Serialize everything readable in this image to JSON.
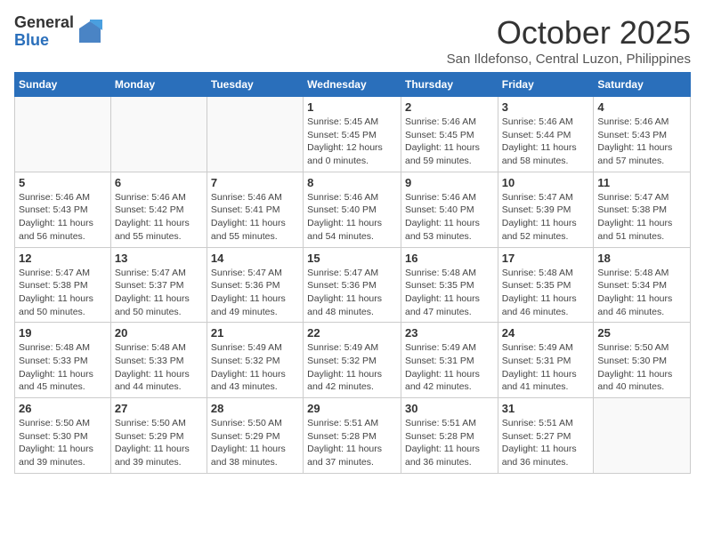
{
  "logo": {
    "general": "General",
    "blue": "Blue"
  },
  "title": "October 2025",
  "subtitle": "San Ildefonso, Central Luzon, Philippines",
  "days_of_week": [
    "Sunday",
    "Monday",
    "Tuesday",
    "Wednesday",
    "Thursday",
    "Friday",
    "Saturday"
  ],
  "weeks": [
    [
      {
        "day": "",
        "info": ""
      },
      {
        "day": "",
        "info": ""
      },
      {
        "day": "",
        "info": ""
      },
      {
        "day": "1",
        "info": "Sunrise: 5:45 AM\nSunset: 5:45 PM\nDaylight: 12 hours\nand 0 minutes."
      },
      {
        "day": "2",
        "info": "Sunrise: 5:46 AM\nSunset: 5:45 PM\nDaylight: 11 hours\nand 59 minutes."
      },
      {
        "day": "3",
        "info": "Sunrise: 5:46 AM\nSunset: 5:44 PM\nDaylight: 11 hours\nand 58 minutes."
      },
      {
        "day": "4",
        "info": "Sunrise: 5:46 AM\nSunset: 5:43 PM\nDaylight: 11 hours\nand 57 minutes."
      }
    ],
    [
      {
        "day": "5",
        "info": "Sunrise: 5:46 AM\nSunset: 5:43 PM\nDaylight: 11 hours\nand 56 minutes."
      },
      {
        "day": "6",
        "info": "Sunrise: 5:46 AM\nSunset: 5:42 PM\nDaylight: 11 hours\nand 55 minutes."
      },
      {
        "day": "7",
        "info": "Sunrise: 5:46 AM\nSunset: 5:41 PM\nDaylight: 11 hours\nand 55 minutes."
      },
      {
        "day": "8",
        "info": "Sunrise: 5:46 AM\nSunset: 5:40 PM\nDaylight: 11 hours\nand 54 minutes."
      },
      {
        "day": "9",
        "info": "Sunrise: 5:46 AM\nSunset: 5:40 PM\nDaylight: 11 hours\nand 53 minutes."
      },
      {
        "day": "10",
        "info": "Sunrise: 5:47 AM\nSunset: 5:39 PM\nDaylight: 11 hours\nand 52 minutes."
      },
      {
        "day": "11",
        "info": "Sunrise: 5:47 AM\nSunset: 5:38 PM\nDaylight: 11 hours\nand 51 minutes."
      }
    ],
    [
      {
        "day": "12",
        "info": "Sunrise: 5:47 AM\nSunset: 5:38 PM\nDaylight: 11 hours\nand 50 minutes."
      },
      {
        "day": "13",
        "info": "Sunrise: 5:47 AM\nSunset: 5:37 PM\nDaylight: 11 hours\nand 50 minutes."
      },
      {
        "day": "14",
        "info": "Sunrise: 5:47 AM\nSunset: 5:36 PM\nDaylight: 11 hours\nand 49 minutes."
      },
      {
        "day": "15",
        "info": "Sunrise: 5:47 AM\nSunset: 5:36 PM\nDaylight: 11 hours\nand 48 minutes."
      },
      {
        "day": "16",
        "info": "Sunrise: 5:48 AM\nSunset: 5:35 PM\nDaylight: 11 hours\nand 47 minutes."
      },
      {
        "day": "17",
        "info": "Sunrise: 5:48 AM\nSunset: 5:35 PM\nDaylight: 11 hours\nand 46 minutes."
      },
      {
        "day": "18",
        "info": "Sunrise: 5:48 AM\nSunset: 5:34 PM\nDaylight: 11 hours\nand 46 minutes."
      }
    ],
    [
      {
        "day": "19",
        "info": "Sunrise: 5:48 AM\nSunset: 5:33 PM\nDaylight: 11 hours\nand 45 minutes."
      },
      {
        "day": "20",
        "info": "Sunrise: 5:48 AM\nSunset: 5:33 PM\nDaylight: 11 hours\nand 44 minutes."
      },
      {
        "day": "21",
        "info": "Sunrise: 5:49 AM\nSunset: 5:32 PM\nDaylight: 11 hours\nand 43 minutes."
      },
      {
        "day": "22",
        "info": "Sunrise: 5:49 AM\nSunset: 5:32 PM\nDaylight: 11 hours\nand 42 minutes."
      },
      {
        "day": "23",
        "info": "Sunrise: 5:49 AM\nSunset: 5:31 PM\nDaylight: 11 hours\nand 42 minutes."
      },
      {
        "day": "24",
        "info": "Sunrise: 5:49 AM\nSunset: 5:31 PM\nDaylight: 11 hours\nand 41 minutes."
      },
      {
        "day": "25",
        "info": "Sunrise: 5:50 AM\nSunset: 5:30 PM\nDaylight: 11 hours\nand 40 minutes."
      }
    ],
    [
      {
        "day": "26",
        "info": "Sunrise: 5:50 AM\nSunset: 5:30 PM\nDaylight: 11 hours\nand 39 minutes."
      },
      {
        "day": "27",
        "info": "Sunrise: 5:50 AM\nSunset: 5:29 PM\nDaylight: 11 hours\nand 39 minutes."
      },
      {
        "day": "28",
        "info": "Sunrise: 5:50 AM\nSunset: 5:29 PM\nDaylight: 11 hours\nand 38 minutes."
      },
      {
        "day": "29",
        "info": "Sunrise: 5:51 AM\nSunset: 5:28 PM\nDaylight: 11 hours\nand 37 minutes."
      },
      {
        "day": "30",
        "info": "Sunrise: 5:51 AM\nSunset: 5:28 PM\nDaylight: 11 hours\nand 36 minutes."
      },
      {
        "day": "31",
        "info": "Sunrise: 5:51 AM\nSunset: 5:27 PM\nDaylight: 11 hours\nand 36 minutes."
      },
      {
        "day": "",
        "info": ""
      }
    ]
  ]
}
